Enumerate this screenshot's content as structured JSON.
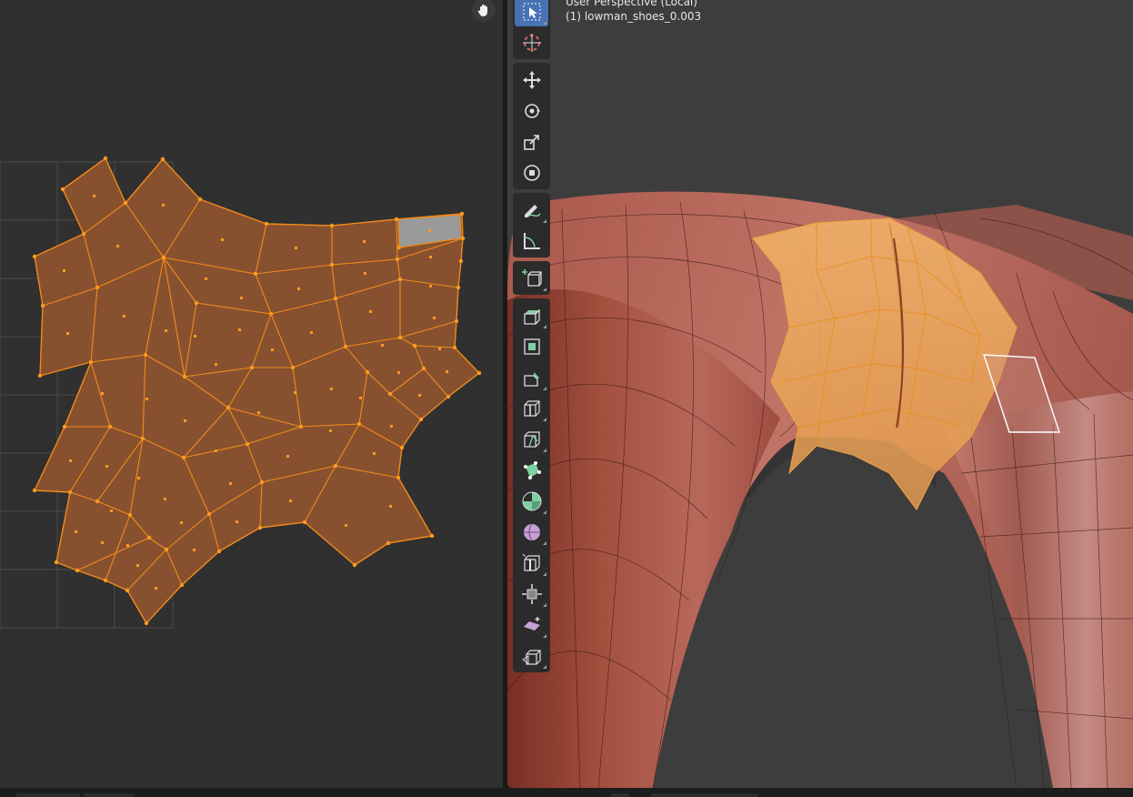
{
  "uv_editor": {
    "name": "UV Editor"
  },
  "viewport": {
    "view_label": "User Perspective (Local)",
    "object_label": "(1) lowman_shoes_0.003"
  },
  "toolbar": {
    "groups": [
      [
        "select-box-tool",
        "cursor-tool"
      ],
      [
        "move-tool",
        "rotate-tool",
        "scale-tool",
        "transform-tool"
      ],
      [
        "annotate-tool",
        "measure-tool"
      ],
      [
        "add-cube-tool"
      ],
      [
        "extrude-region-tool",
        "inset-faces-tool",
        "bevel-tool",
        "loop-cut-tool",
        "knife-tool",
        "poly-build-tool",
        "spin-tool",
        "smooth-tool",
        "edge-slide-tool",
        "shrink-fatten-tool",
        "shear-tool",
        "rip-region-tool"
      ]
    ]
  },
  "colors": {
    "uv_face": "#8a5330",
    "uv_edge": "#f08a1a",
    "uv_selected_face": "#9a9a9a",
    "mesh_skin": "#b86a5c",
    "mesh_selection": "#f0a040",
    "active_tool": "#4772b3"
  }
}
